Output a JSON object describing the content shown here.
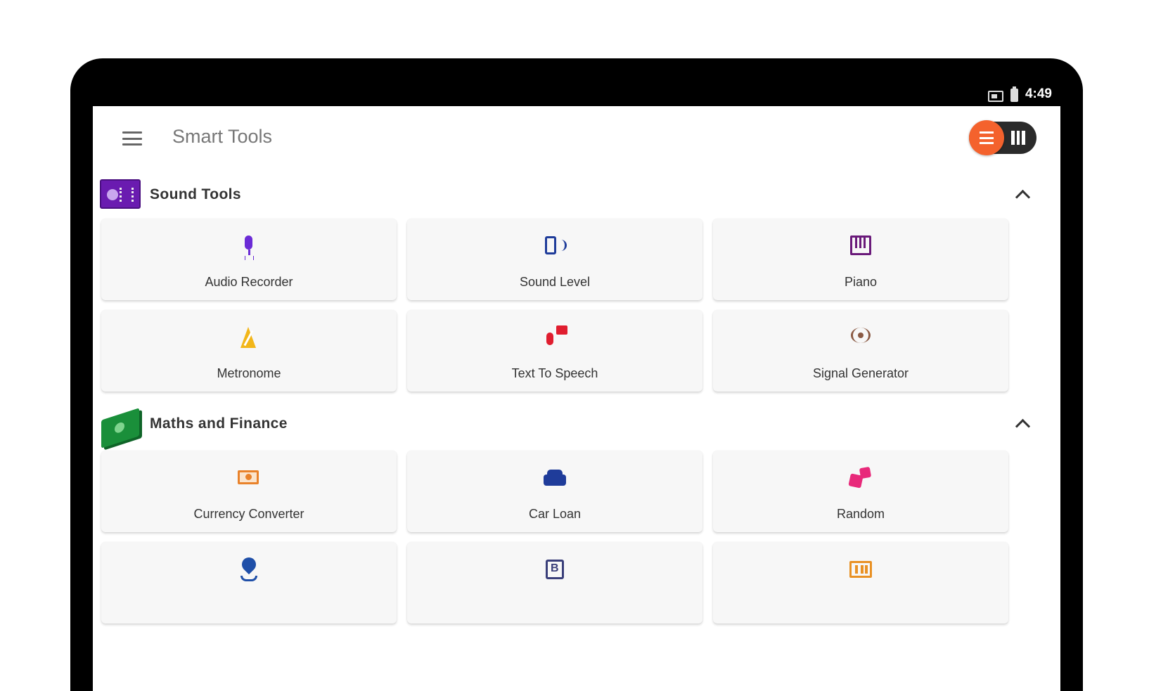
{
  "status_bar": {
    "time": "4:49"
  },
  "app_bar": {
    "title": "Smart Tools"
  },
  "sections": [
    {
      "title": "Sound Tools",
      "tools": [
        {
          "label": "Audio Recorder",
          "icon": "microphone-icon"
        },
        {
          "label": "Sound Level",
          "icon": "speaker-icon"
        },
        {
          "label": "Piano",
          "icon": "piano-icon"
        },
        {
          "label": "Metronome",
          "icon": "metronome-icon"
        },
        {
          "label": "Text To Speech",
          "icon": "text-to-speech-icon"
        },
        {
          "label": "Signal Generator",
          "icon": "signal-icon"
        }
      ]
    },
    {
      "title": "Maths and Finance",
      "tools": [
        {
          "label": "Currency Converter",
          "icon": "currency-icon"
        },
        {
          "label": "Car Loan",
          "icon": "car-icon"
        },
        {
          "label": "Random",
          "icon": "dice-icon"
        },
        {
          "label": "",
          "icon": "location-pin-icon"
        },
        {
          "label": "",
          "icon": "binary-icon"
        },
        {
          "label": "",
          "icon": "ruler-icon"
        }
      ]
    }
  ],
  "colors": {
    "accent": "#f4622d",
    "toggle_track": "#2b2b2b",
    "card_bg": "#f7f7f7"
  }
}
